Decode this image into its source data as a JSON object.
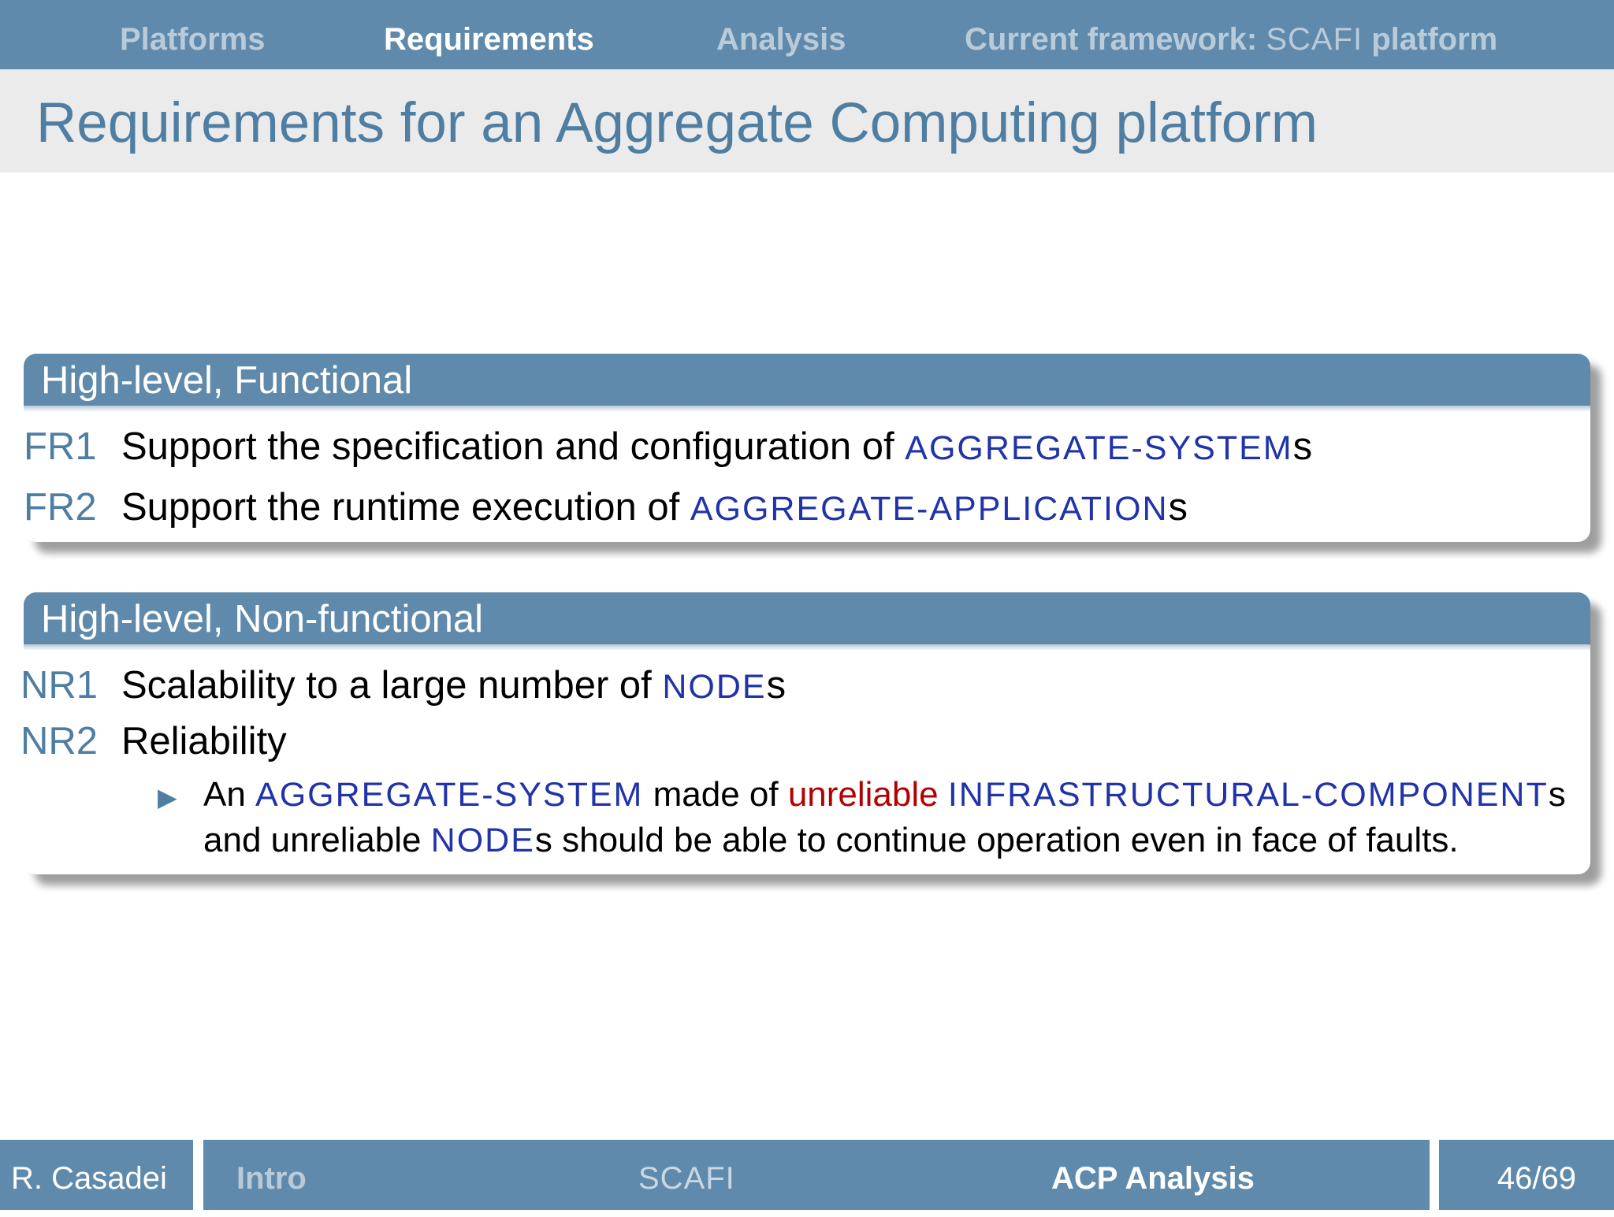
{
  "nav": {
    "items": [
      {
        "label": "Platforms"
      },
      {
        "label": "Requirements"
      },
      {
        "label": "Analysis"
      },
      {
        "label": "Current framework:",
        "term": "SCAFI",
        "suffix": "platform"
      }
    ]
  },
  "title": "Requirements for an Aggregate Computing platform",
  "functional": {
    "heading": "High-level, Functional",
    "items": [
      {
        "id": "FR1",
        "text": "Support the specification and configuration of ",
        "term": "AGGREGATE-SYSTEM",
        "tail": "s"
      },
      {
        "id": "FR2",
        "text": "Support the runtime execution of ",
        "term": "AGGREGATE-APPLICATION",
        "tail": "s"
      }
    ]
  },
  "nonfunctional": {
    "heading": "High-level, Non-functional",
    "items": [
      {
        "id": "NR1",
        "text": "Scalability to a large number of ",
        "term": "NODE",
        "tail": "s"
      },
      {
        "id": "NR2",
        "text": "Reliability"
      }
    ],
    "sub": {
      "bullet": "▶",
      "p1": "An ",
      "t1": "AGGREGATE-SYSTEM",
      "p2": " made of ",
      "red": "unreliable",
      "p3": " ",
      "t2": "INFRASTRUCTURAL-COMPONENT",
      "p4": "s and unreliable ",
      "t3": "NODE",
      "p5": "s should be able to continue operation even in face of faults."
    }
  },
  "footer": {
    "author": "R. Casadei",
    "section": "Intro",
    "middle": "SCAFI",
    "subsection": "ACP Analysis",
    "page": "46/69"
  },
  "colors": {
    "theme": "#5f8aab",
    "title": "#4f7ea3",
    "term": "#2033a8",
    "alert": "#b30000"
  }
}
